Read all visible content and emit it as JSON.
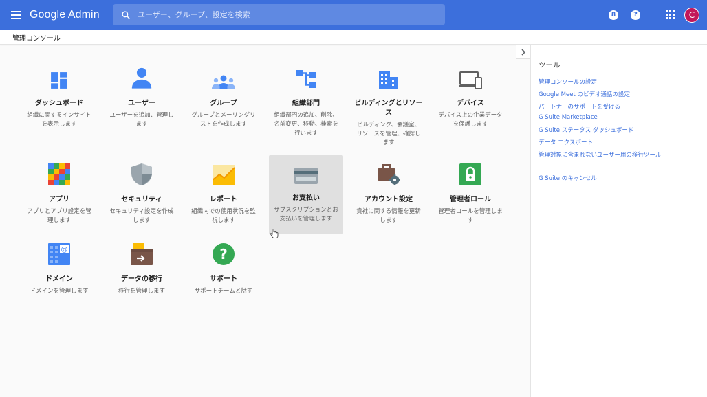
{
  "header": {
    "logo": "Google Admin",
    "search_placeholder": "ユーザー、グループ、設定を検索",
    "notification_count": "8",
    "help_label": "?",
    "avatar_initial": "C"
  },
  "breadcrumb": {
    "title": "管理コンソール"
  },
  "tiles": [
    {
      "title": "ダッシュボード",
      "desc": "組織に関するインサイトを表示します",
      "icon": "dashboard-icon"
    },
    {
      "title": "ユーザー",
      "desc": "ユーザーを追加、管理します",
      "icon": "user-icon"
    },
    {
      "title": "グループ",
      "desc": "グループとメーリングリストを作成します",
      "icon": "group-icon"
    },
    {
      "title": "組織部門",
      "desc": "組織部門の追加、削除、名前変更、移動、検索を行います",
      "icon": "org-units-icon"
    },
    {
      "title": "ビルディングとリソース",
      "desc": "ビルディング、会議室、リソースを管理、確認します",
      "icon": "building-icon"
    },
    {
      "title": "デバイス",
      "desc": "デバイス上の企業データを保護します",
      "icon": "devices-icon"
    },
    {
      "title": "アプリ",
      "desc": "アプリとアプリ設定を管理します",
      "icon": "apps-icon"
    },
    {
      "title": "セキュリティ",
      "desc": "セキュリティ設定を作成します",
      "icon": "shield-icon"
    },
    {
      "title": "レポート",
      "desc": "組織内での使用状況を監視します",
      "icon": "reports-icon"
    },
    {
      "title": "お支払い",
      "desc": "サブスクリプションとお支払いを管理します",
      "icon": "billing-card-icon"
    },
    {
      "title": "アカウント設定",
      "desc": "貴社に関する情報を更新します",
      "icon": "briefcase-gear-icon"
    },
    {
      "title": "管理者ロール",
      "desc": "管理者ロールを管理します",
      "icon": "lock-icon"
    },
    {
      "title": "ドメイン",
      "desc": "ドメインを管理します",
      "icon": "domain-icon"
    },
    {
      "title": "データの移行",
      "desc": "移行を管理します",
      "icon": "data-migration-icon"
    },
    {
      "title": "サポート",
      "desc": "サポートチームと話す",
      "icon": "help-support-icon"
    }
  ],
  "sidebar": {
    "heading": "ツール",
    "links": [
      "管理コンソールの設定",
      "Google Meet のビデオ通話の設定",
      "パートナーのサポートを受ける",
      "G Suite Marketplace",
      "G Suite ステータス ダッシュボード",
      "データ エクスポート",
      "管理対象に含まれないユーザー用の移行ツール"
    ],
    "cancel_link": "G Suite のキャンセル"
  },
  "colors": {
    "brand_blue": "#3c6fdc",
    "icon_blue": "#4285f4",
    "avatar": "#c2185b",
    "highlight": "#e0e0e0"
  }
}
